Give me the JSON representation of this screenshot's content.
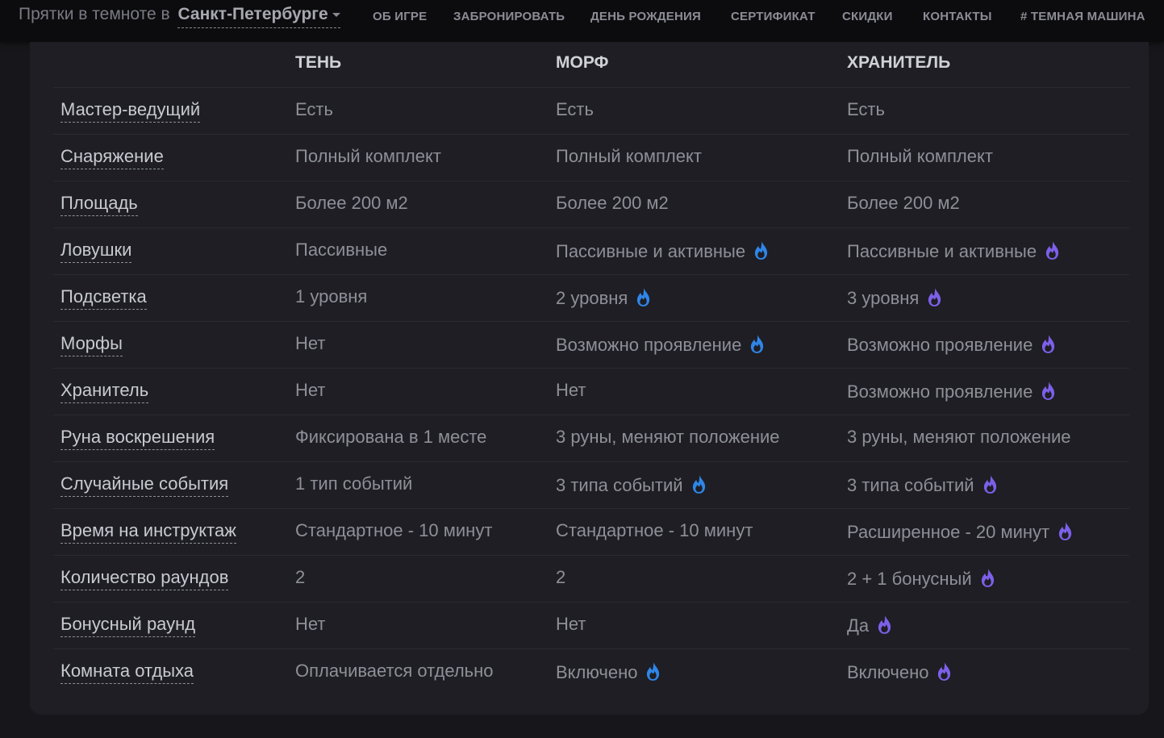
{
  "header": {
    "brand_prefix": "Прятки в темноте в",
    "city": "Санкт-Петербурге",
    "nav": [
      "ОБ ИГРЕ",
      "ЗАБРОНИРОВАТЬ",
      "ДЕНЬ РОЖДЕНИЯ",
      "СЕРТИФИКАТ",
      "СКИДКИ",
      "КОНТАКТЫ",
      "# ТЕМНАЯ МАШИНА"
    ]
  },
  "table": {
    "columns": [
      "ТЕНЬ",
      "МОРФ",
      "ХРАНИТЕЛЬ"
    ],
    "rows": [
      {
        "label": "Мастер-ведущий",
        "cells": [
          "Есть",
          "Есть",
          "Есть"
        ],
        "flames": [
          false,
          false,
          false
        ]
      },
      {
        "label": "Снаряжение",
        "cells": [
          "Полный комплект",
          "Полный комплект",
          "Полный комплект"
        ],
        "flames": [
          false,
          false,
          false
        ]
      },
      {
        "label": "Площадь",
        "cells": [
          "Более 200 м2",
          "Более 200 м2",
          "Более 200 м2"
        ],
        "flames": [
          false,
          false,
          false
        ]
      },
      {
        "label": "Ловушки",
        "cells": [
          "Пассивные",
          "Пассивные и активные",
          "Пассивные и активные"
        ],
        "flames": [
          false,
          true,
          true
        ]
      },
      {
        "label": "Подсветка",
        "cells": [
          "1 уровня",
          "2 уровня",
          "3 уровня"
        ],
        "flames": [
          false,
          true,
          true
        ]
      },
      {
        "label": "Морфы",
        "cells": [
          "Нет",
          "Возможно проявление",
          "Возможно проявление"
        ],
        "flames": [
          false,
          true,
          true
        ]
      },
      {
        "label": "Хранитель",
        "cells": [
          "Нет",
          "Нет",
          "Возможно проявление"
        ],
        "flames": [
          false,
          false,
          true
        ]
      },
      {
        "label": "Руна воскрешения",
        "cells": [
          "Фиксирована в 1 месте",
          "3 руны, меняют положение",
          "3 руны, меняют положение"
        ],
        "flames": [
          false,
          false,
          false
        ]
      },
      {
        "label": "Случайные события",
        "cells": [
          "1 тип событий",
          "3 типа событий",
          "3 типа событий"
        ],
        "flames": [
          false,
          true,
          true
        ]
      },
      {
        "label": "Время на инструктаж",
        "cells": [
          "Стандартное - 10 минут",
          "Стандартное - 10 минут",
          "Расширенное - 20 минут"
        ],
        "flames": [
          false,
          false,
          true
        ]
      },
      {
        "label": "Количество раундов",
        "cells": [
          "2",
          "2",
          "2 + 1 бонусный"
        ],
        "flames": [
          false,
          false,
          true
        ]
      },
      {
        "label": "Бонусный раунд",
        "cells": [
          "Нет",
          "Нет",
          "Да"
        ],
        "flames": [
          false,
          false,
          true
        ]
      },
      {
        "label": "Комната отдыха",
        "cells": [
          "Оплачивается отдельно",
          "Включено",
          "Включено"
        ],
        "flames": [
          false,
          true,
          true
        ]
      }
    ]
  },
  "icons": {
    "flame_morph": "flame-icon-blue",
    "flame_keeper": "flame-icon-purple"
  },
  "colors": {
    "flame_blue": "#2f86e8",
    "flame_purple": "#7d60ea",
    "page_bg": "#17171b",
    "card_bg": "#1e1e24",
    "topbar_bg": "#0c0c0e"
  }
}
